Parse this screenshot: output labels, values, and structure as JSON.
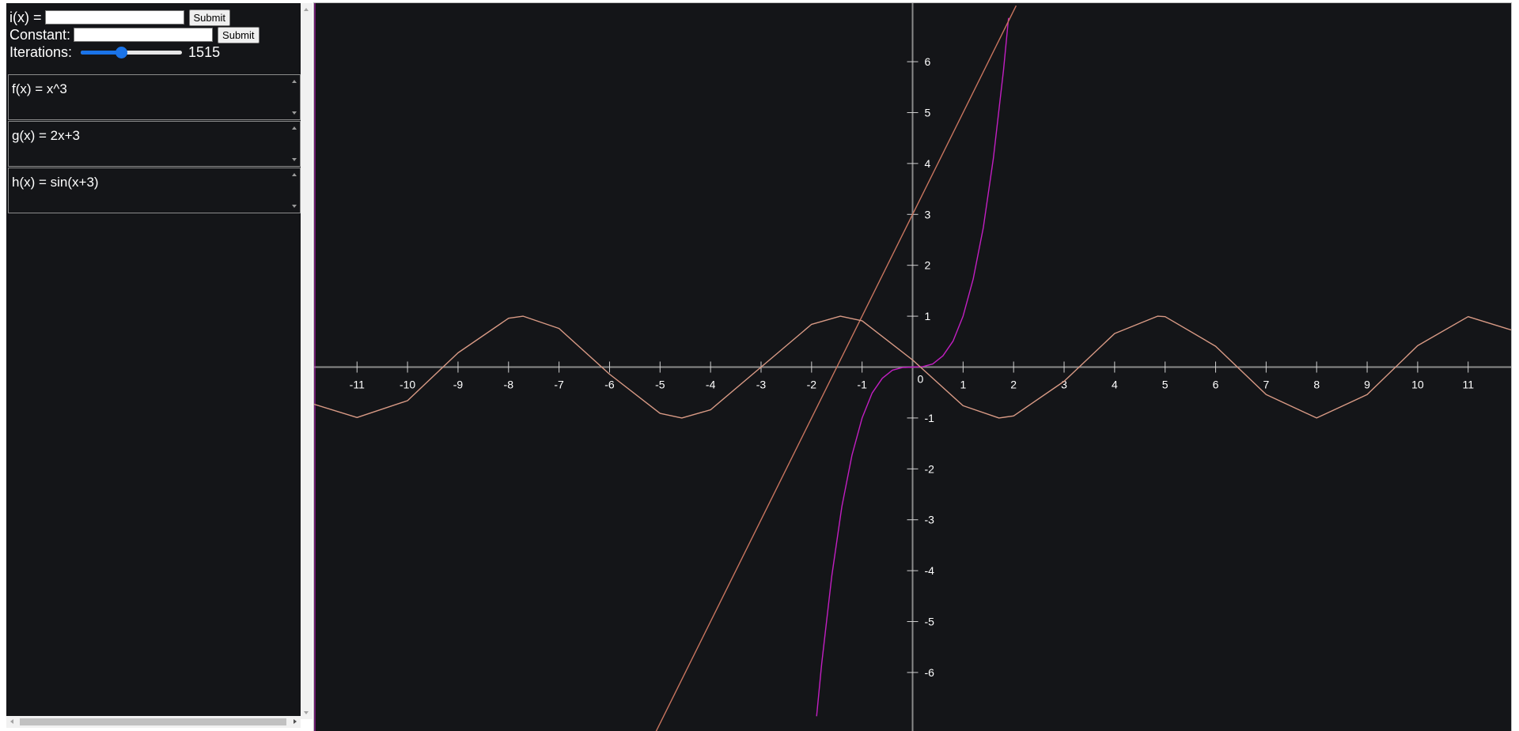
{
  "controls": {
    "i_label": "i(x) =",
    "i_value": "",
    "i_submit": "Submit",
    "constant_label": "Constant:",
    "constant_value": "",
    "constant_submit": "Submit",
    "iterations_label": "Iterations:",
    "iterations_value": "1515",
    "iterations_slider_fraction": 0.4
  },
  "functions": [
    {
      "text": "f(x) = x^3"
    },
    {
      "text": "g(x) = 2x+3"
    },
    {
      "text": "h(x) = sin(x+3)"
    }
  ],
  "chart_data": {
    "type": "line",
    "title": "",
    "xlabel": "",
    "ylabel": "",
    "xlim": [
      -11.85,
      11.85
    ],
    "ylim": [
      -7.15,
      7.15
    ],
    "grid": false,
    "legend": "none",
    "x_ticks": [
      -11,
      -10,
      -9,
      -8,
      -7,
      -6,
      -5,
      -4,
      -3,
      -2,
      -1,
      1,
      2,
      3,
      4,
      5,
      6,
      7,
      8,
      9,
      10,
      11
    ],
    "y_ticks": [
      -6,
      -5,
      -4,
      -3,
      -2,
      -1,
      1,
      2,
      3,
      4,
      5,
      6
    ],
    "origin_label": "0",
    "series": [
      {
        "expr": "x^3",
        "color": "#c21fc2",
        "x": [
          -1.9,
          -1.8,
          -1.6,
          -1.4,
          -1.2,
          -1.0,
          -0.8,
          -0.6,
          -0.4,
          -0.2,
          0,
          0.2,
          0.4,
          0.6,
          0.8,
          1.0,
          1.2,
          1.4,
          1.6,
          1.8,
          1.9
        ],
        "y": [
          -6.86,
          -5.83,
          -4.1,
          -2.74,
          -1.73,
          -1.0,
          -0.51,
          -0.22,
          -0.06,
          -0.01,
          0,
          0.01,
          0.06,
          0.22,
          0.51,
          1.0,
          1.73,
          2.74,
          4.1,
          5.83,
          6.86
        ]
      },
      {
        "expr": "2x+3",
        "color": "#c8755f",
        "x": [
          -5.15,
          2.05
        ],
        "y": [
          -7.3,
          7.1
        ]
      },
      {
        "expr": "sin(x+3)",
        "color": "#d99a85",
        "x": [
          -11.85,
          -11,
          -10,
          -9,
          -8,
          -7.71,
          -7,
          -6,
          -5,
          -4.57,
          -4,
          -3,
          -2,
          -1.43,
          -1,
          0,
          1,
          1.71,
          2,
          3,
          4,
          4.85,
          5,
          6,
          7,
          8,
          9,
          10,
          11,
          11.85
        ],
        "y": [
          -0.73,
          -0.99,
          -0.66,
          0.28,
          0.96,
          1.0,
          0.76,
          -0.14,
          -0.91,
          -1.0,
          -0.84,
          0.0,
          0.84,
          1.0,
          0.91,
          0.14,
          -0.76,
          -1.0,
          -0.96,
          -0.28,
          0.66,
          1.0,
          0.99,
          0.41,
          -0.54,
          -1.0,
          -0.54,
          0.42,
          0.99,
          0.73
        ]
      }
    ]
  }
}
